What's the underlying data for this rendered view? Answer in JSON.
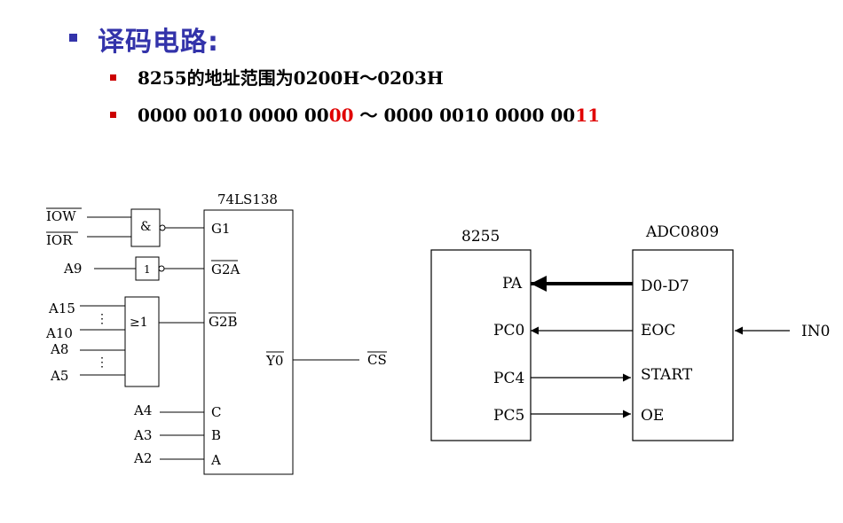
{
  "heading": "译码电路:",
  "bullets": {
    "range": "8255的地址范围为0200H～0203H",
    "bits_a": "0000 0010 0000 00",
    "bits_a_red": "00",
    "tilde": " ～ ",
    "bits_b": "0000 0010 0000 00",
    "bits_b_red": "11"
  },
  "decoder": {
    "chip": "74LS138",
    "iow": "IOW",
    "ior": "IOR",
    "and_gate": "&",
    "a9": "A9",
    "not_gate": "1",
    "a15": "A15",
    "a10": "A10",
    "a8": "A8",
    "a5": "A5",
    "or_gate": "≥1",
    "dots": "⋮",
    "g1": "G1",
    "g2a": "G2A",
    "g2b": "G2B",
    "y0": "Y0",
    "cs": "CS",
    "a4": "A4",
    "a3": "A3",
    "a2": "A2",
    "c": "C",
    "b": "B",
    "a": "A"
  },
  "interface": {
    "chip_left": "8255",
    "chip_right": "ADC0809",
    "pa": "PA",
    "pc0": "PC0",
    "pc4": "PC4",
    "pc5": "PC5",
    "d0d7": "D0-D7",
    "eoc": "EOC",
    "start": "START",
    "oe": "OE",
    "in0": "IN0"
  }
}
